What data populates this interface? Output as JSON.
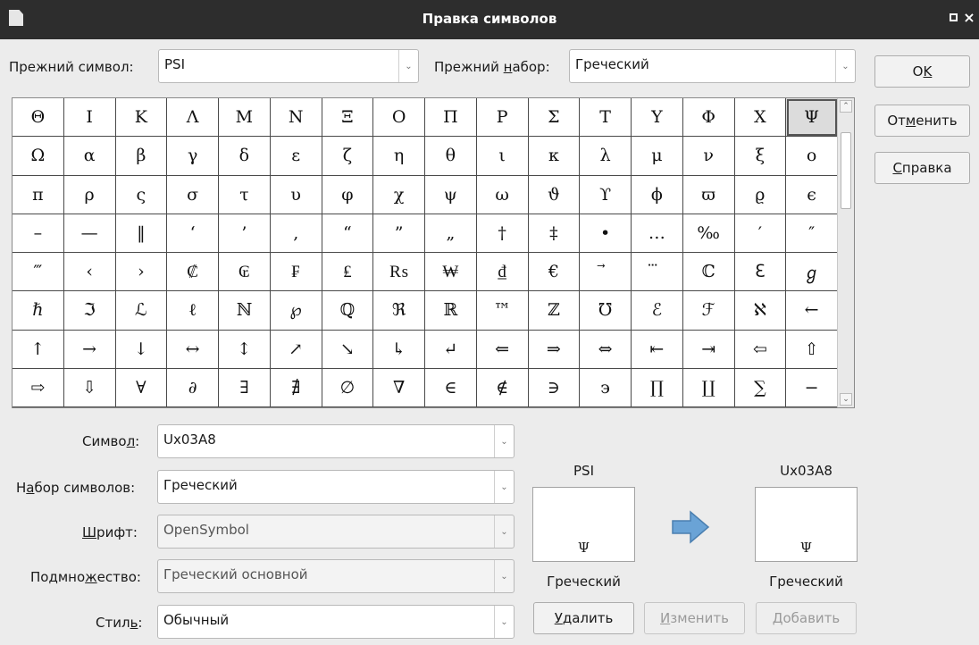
{
  "window": {
    "title": "Правка символов",
    "close_glyph": "×"
  },
  "old_symbol": {
    "label_pre": "Прежний символ:",
    "value": "PSI"
  },
  "old_set": {
    "label_pre": "Прежний ",
    "label_u": "н",
    "label_post": "абор:",
    "value": "Греческий"
  },
  "buttons": {
    "ok_pre": "O",
    "ok_u": "K",
    "cancel_pre": "От",
    "cancel_u": "м",
    "cancel_post": "енить",
    "help_u": "С",
    "help_post": "правка",
    "delete_u": "У",
    "delete_post": "далить",
    "modify_u": "И",
    "modify_post": "зменить",
    "add_u": "Д",
    "add_post": "обавить"
  },
  "symbol_grid": [
    [
      "Θ",
      "Ι",
      "Κ",
      "Λ",
      "Μ",
      "Ν",
      "Ξ",
      "Ο",
      "Π",
      "Ρ",
      "Σ",
      "Τ",
      "Υ",
      "Φ",
      "Χ",
      "Ψ"
    ],
    [
      "Ω",
      "α",
      "β",
      "γ",
      "δ",
      "ε",
      "ζ",
      "η",
      "θ",
      "ι",
      "κ",
      "λ",
      "μ",
      "ν",
      "ξ",
      "ο"
    ],
    [
      "π",
      "ρ",
      "ς",
      "σ",
      "τ",
      "υ",
      "φ",
      "χ",
      "ψ",
      "ω",
      "ϑ",
      "ϒ",
      "ϕ",
      "ϖ",
      "ϱ",
      "ϵ"
    ],
    [
      "–",
      "—",
      "‖",
      "‘",
      "’",
      "‚",
      "“",
      "”",
      "„",
      "†",
      "‡",
      "•",
      "…",
      "‰",
      "′",
      "″"
    ],
    [
      "‴",
      "‹",
      "›",
      "₡",
      "₢",
      "₣",
      "₤",
      "₨",
      "₩",
      "₫",
      "€",
      "⃗",
      "⃛",
      "ℂ",
      "ℇ",
      "ℊ"
    ],
    [
      "ℏ",
      "ℑ",
      "ℒ",
      "ℓ",
      "ℕ",
      "℘",
      "ℚ",
      "ℜ",
      "ℝ",
      "™",
      "ℤ",
      "℧",
      "ℰ",
      "ℱ",
      "ℵ",
      "←"
    ],
    [
      "↑",
      "→",
      "↓",
      "↔",
      "↕",
      "↗",
      "↘",
      "↳",
      "↵",
      "⇐",
      "⇒",
      "⇔",
      "⇤",
      "⇥",
      "⇦",
      "⇧"
    ],
    [
      "⇨",
      "⇩",
      "∀",
      "∂",
      "∃",
      "∄",
      "∅",
      "∇",
      "∈",
      "∉",
      "∋",
      "϶",
      "∏",
      "∐",
      "∑",
      "−"
    ]
  ],
  "selected_cell": {
    "row": 0,
    "col": 15
  },
  "symbol": {
    "label_pre": "Симво",
    "label_u": "л",
    "label_post": ":",
    "value": "Ux03A8"
  },
  "symbol_set": {
    "label_pre": "Н",
    "label_u": "а",
    "label_post": "бор символов:",
    "value": "Греческий"
  },
  "font": {
    "label_u": "Ш",
    "label_post": "рифт:",
    "value": "OpenSymbol"
  },
  "subset": {
    "label_pre": "Подмно",
    "label_u": "ж",
    "label_post": "ество:",
    "value": "Греческий основной"
  },
  "style": {
    "label_pre": "Стил",
    "label_u": "ь",
    "label_post": ":",
    "value": "Обычный"
  },
  "preview_old": {
    "name": "PSI",
    "glyph": "Ψ",
    "set": "Греческий"
  },
  "preview_new": {
    "name": "Ux03A8",
    "glyph": "Ψ",
    "set": "Греческий"
  },
  "colors": {
    "arrow": "#6aa3d6",
    "titlebar": "#2d2d2d"
  }
}
